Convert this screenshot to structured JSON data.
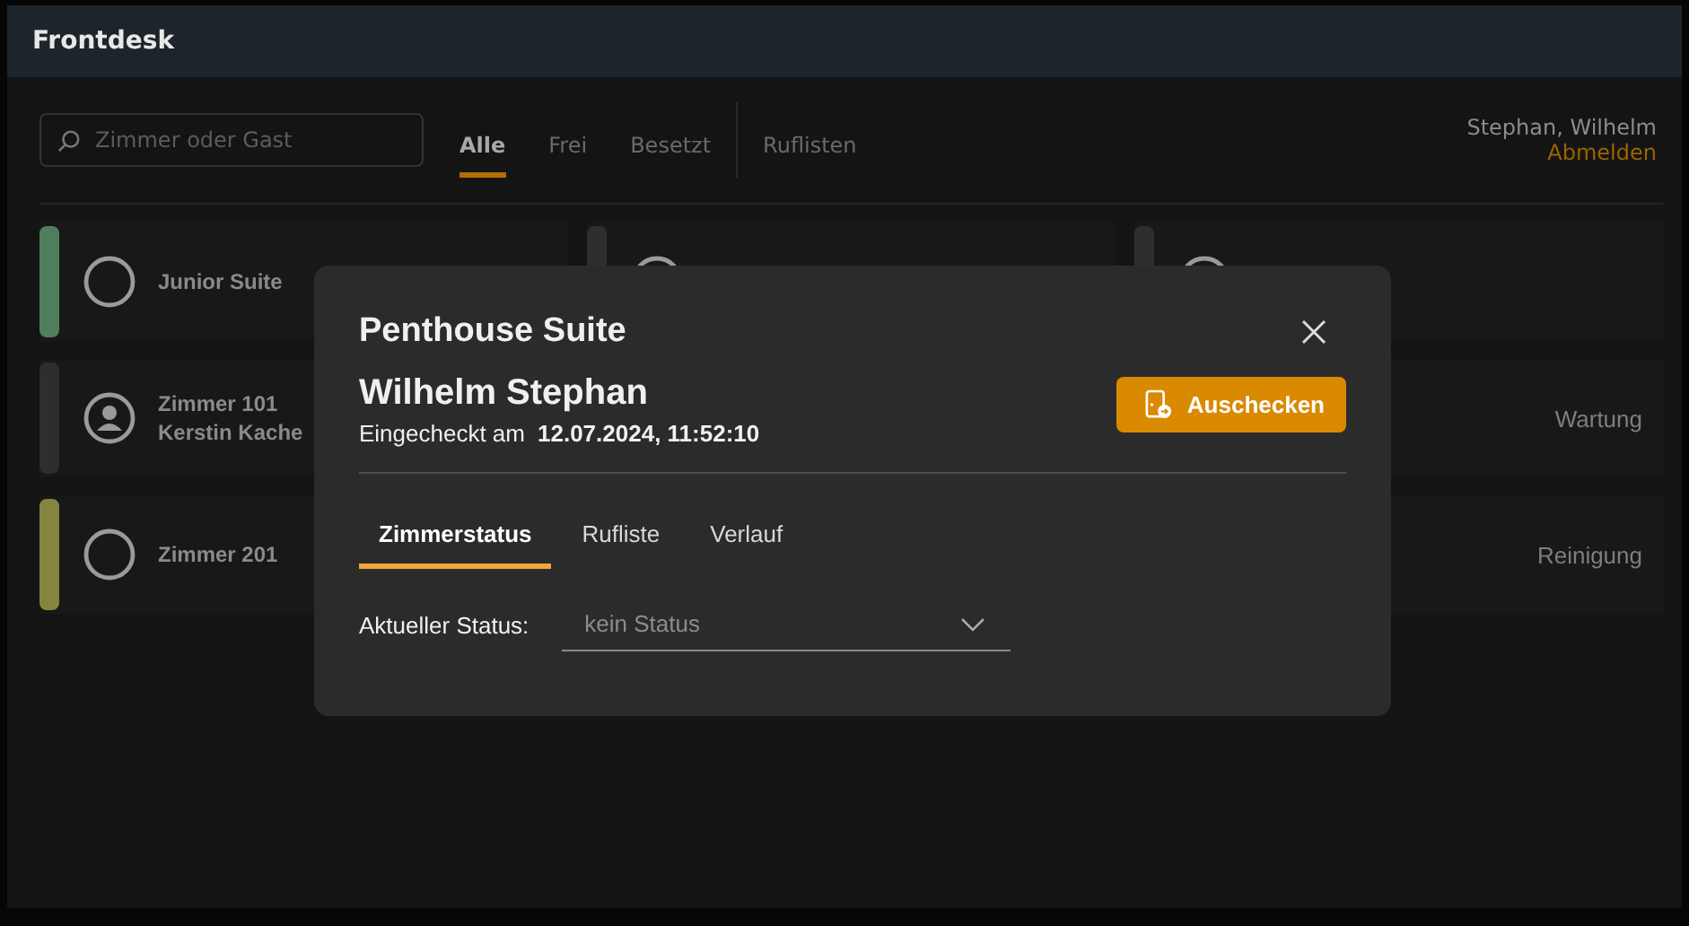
{
  "window": {
    "title": "Frontdesk"
  },
  "search": {
    "placeholder": "Zimmer oder Gast"
  },
  "filters": [
    {
      "label": "Alle",
      "selected": true
    },
    {
      "label": "Frei",
      "selected": false
    },
    {
      "label": "Besetzt",
      "selected": false
    },
    {
      "label": "Ruflisten",
      "selected": false
    }
  ],
  "user": {
    "name": "Stephan, Wilhelm",
    "logout": "Abmelden"
  },
  "columns": [
    {
      "rooms": [
        {
          "kind": "vacant",
          "color": "#4f7f5d",
          "title": "Junior Suite"
        },
        {
          "kind": "occupied",
          "color": "#2e2e2e",
          "title": "Zimmer 101",
          "guest": "Kerstin Kache"
        },
        {
          "kind": "vacant",
          "color": "#85853f",
          "title": "Zimmer 201"
        }
      ]
    },
    {
      "rooms": [
        {
          "kind": "vacant",
          "color": "#2e2e2e"
        }
      ]
    },
    {
      "rooms": [
        {
          "kind": "vacant",
          "color": "#2e2e2e"
        },
        {
          "kind": "covered",
          "status": "Wartung"
        },
        {
          "kind": "covered",
          "status": "Reinigung"
        }
      ]
    }
  ],
  "dialog": {
    "title": "Penthouse Suite",
    "guest": "Wilhelm Stephan",
    "checkin_label": "Eingecheckt am",
    "checkin_time": "12.07.2024, 11:52:10",
    "action": "Auschecken",
    "tabs": [
      {
        "label": "Zimmerstatus",
        "selected": true
      },
      {
        "label": "Rufliste",
        "selected": false
      },
      {
        "label": "Verlauf",
        "selected": false
      }
    ],
    "status_label": "Aktueller Status:",
    "status_placeholder": "kein Status"
  }
}
